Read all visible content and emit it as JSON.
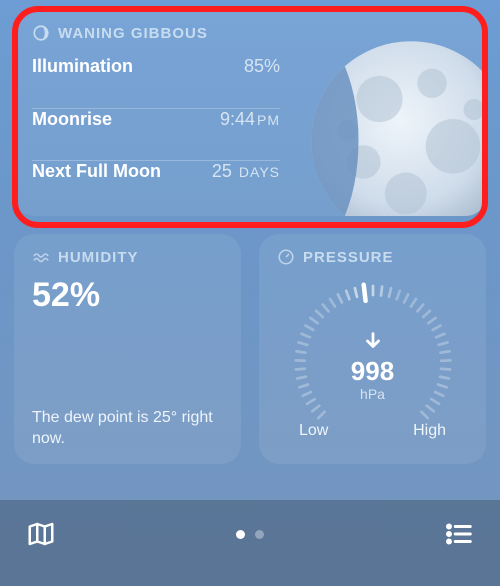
{
  "moon": {
    "phase_label": "WANING GIBBOUS",
    "rows": {
      "illumination": {
        "label": "Illumination",
        "value": "85%"
      },
      "moonrise": {
        "label": "Moonrise",
        "value_num": "9:44",
        "value_unit": "PM"
      },
      "next_full": {
        "label": "Next Full Moon",
        "value_num": "25",
        "value_unit": "DAYS"
      }
    }
  },
  "humidity": {
    "title": "HUMIDITY",
    "value": "52%",
    "footnote": "The dew point is 25° right now."
  },
  "pressure": {
    "title": "PRESSURE",
    "value": "998",
    "unit": "hPa",
    "trend": "down",
    "low_label": "Low",
    "high_label": "High"
  },
  "bottombar": {
    "page_active": 0,
    "page_count": 2
  },
  "icons": {
    "moon_phase": "moon-phase-icon",
    "humidity": "humidity-icon",
    "pressure": "pressure-gauge-icon",
    "map": "map-icon",
    "list": "list-icon"
  }
}
